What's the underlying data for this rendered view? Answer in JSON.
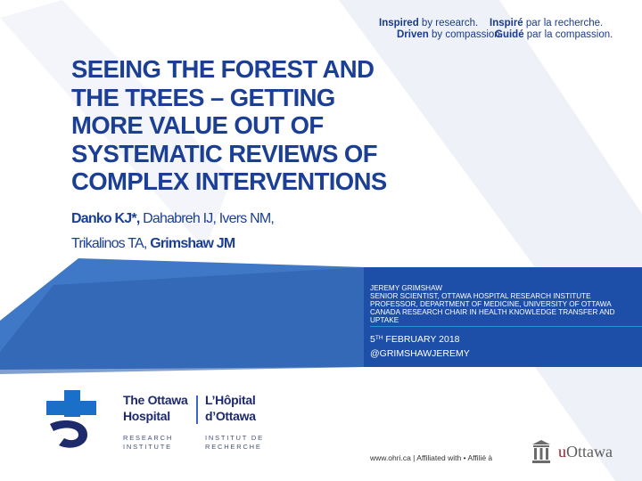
{
  "header": {
    "tagline_en": {
      "line1_bold": "Inspired",
      "line1_rest": " by research.",
      "line2_bold": "Driven",
      "line2_rest": " by compassion."
    },
    "tagline_fr": {
      "line1_bold": "Inspiré",
      "line1_rest": " par la recherche.",
      "line2_bold": "Guidé",
      "line2_rest": " par la compassion."
    }
  },
  "title": {
    "line1": "SEEING THE FOREST AND",
    "line2": "THE TREES – GETTING",
    "line3": "MORE VALUE OUT OF",
    "line4": "SYSTEMATIC REVIEWS OF",
    "line5": "COMPLEX INTERVENTIONS"
  },
  "authors": {
    "lead": "Danko KJ*,",
    "coauthors": " Dahabreh IJ, Ivers NM,",
    "line2_start": "Trikalinos TA, ",
    "senior": "Grimshaw JM"
  },
  "presenter": {
    "name": "JEREMY GRIMSHAW",
    "role1": "SENIOR SCIENTIST, OTTAWA HOSPITAL RESEARCH INSTITUTE",
    "role2": "PROFESSOR, DEPARTMENT OF MEDICINE, UNIVERSITY OF OTTAWA",
    "role3": "CANADA RESEARCH CHAIR IN HEALTH KNOWLEDGE TRANSFER AND",
    "role4": "UPTAKE",
    "date_day": "5",
    "date_suffix": "TH",
    "date_rest": " FEBRUARY 2018",
    "handle": "@GRIMSHAWJEREMY"
  },
  "logo": {
    "en_line1": "The Ottawa",
    "en_line2": "Hospital",
    "fr_line1": "L’Hôpital",
    "fr_line2": "d’Ottawa",
    "en_sub1": "RESEARCH",
    "en_sub2": "INSTITUTE",
    "fr_sub1": "INSTITUT DE",
    "fr_sub2": "RECHERCHE"
  },
  "footer": {
    "text": "www.ohri.ca  |  Affiliated with  •  Affilié à"
  },
  "uottawa": {
    "u": "u",
    "rest": "Ottawa"
  },
  "colors": {
    "title_blue": "#1b3f95",
    "panel_blue": "#1d4ea8",
    "logo_navy": "#1d2a6b",
    "uottawa_red": "#8f1d2c"
  }
}
